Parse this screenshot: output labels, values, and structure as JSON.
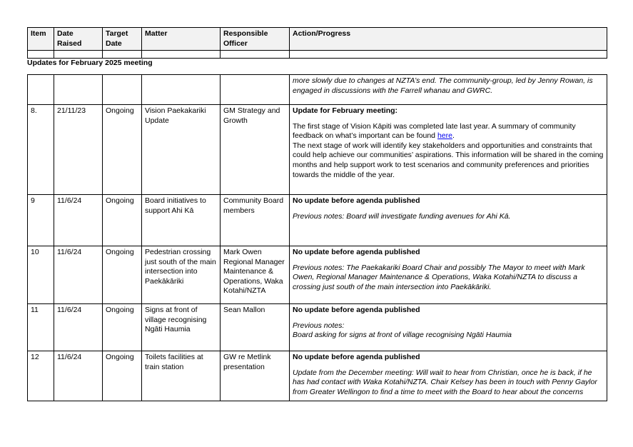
{
  "header": {
    "columns": [
      "Item",
      "Date Raised",
      "Target Date",
      "Matter",
      "Responsible Officer",
      "Action/Progress"
    ],
    "col_date_1": "Date",
    "col_date_2": "Raised",
    "col_target_1": "Target",
    "col_target_2": "Date",
    "col_resp_1": "Responsible",
    "col_resp_2": "Officer"
  },
  "section_title": "Updates for February 2025 meeting",
  "rows": [
    {
      "cont": "more slowly due to changes at NZTA’s end.  The community-group, led by Jenny Rowan, is engaged in discussions with the Farrell whanau and GWRC."
    },
    {
      "item": "8.",
      "date_raised": "21/11/23",
      "target": "Ongoing",
      "matter": "Vision Paekakariki Update",
      "officer": "GM Strategy and Growth",
      "heading": "Update for February meeting:",
      "p1_before": "The first stage of Vision Kāpiti was completed late last year. A summary of community feedback on what’s important can be found ",
      "p1_link": "here",
      "p1_after": ".",
      "p2": "The next stage of work will identify key stakeholders and opportunities and constraints that could help achieve our communities’ aspirations. This information will be shared in the coming months and help support work to test scenarios and community preferences and priorities towards the middle of the year."
    },
    {
      "item": "9",
      "date_raised": "11/6/24",
      "target": "Ongoing",
      "matter": "Board initiatives to support Ahi Kā",
      "officer": "Community Board members",
      "heading": "No update before agenda published",
      "note": "Previous notes: Board will investigate funding avenues for Ahi Kā."
    },
    {
      "item": "10",
      "date_raised": "11/6/24",
      "target": "Ongoing",
      "matter": "Pedestrian crossing just south of the main intersection into Paekākāriki",
      "officer": "Mark Owen Regional Manager Maintenance & Operations, Waka Kotahi/NZTA",
      "heading": "No update before agenda published",
      "note": "Previous notes: The Paekakariki Board Chair and possibly The Mayor to meet with Mark Owen, Regional Manager Maintenance & Operations, Waka Kotahi/NZTA to discuss a crossing just south of the main intersection into Paekākāriki."
    },
    {
      "item": "11",
      "date_raised": "11/6/24",
      "target": "Ongoing",
      "matter": "Signs at front of village recognising Ngāti Haumia",
      "officer": "Sean Mallon",
      "heading": "No update before agenda published",
      "note_label": "Previous notes:",
      "note": "Board asking for signs at front of village recognising Ngāti Haumia"
    },
    {
      "item": "12",
      "date_raised": "11/6/24",
      "target": "Ongoing",
      "matter": "Toilets facilities at train station",
      "officer": "GW re Metlink presentation",
      "heading": "No update before agenda published",
      "note": "Update from the December meeting: Will wait to hear from Christian, once he is back, if he has had contact with Waka Kotahi/NZTA. Chair Kelsey has been in touch with Penny Gaylor from Greater Wellingon to  find a time to meet with the Board to hear about the concerns"
    }
  ]
}
